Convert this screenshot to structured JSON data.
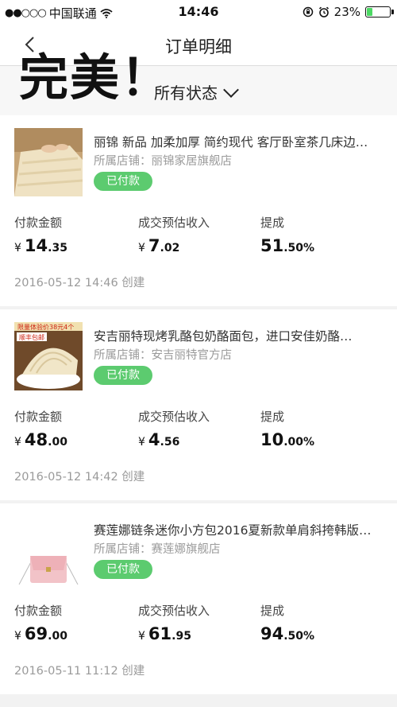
{
  "status_bar": {
    "carrier": "中国联通",
    "time": "14:46",
    "battery": "23%",
    "battery_level": 0.23
  },
  "nav": {
    "title": "订单明细"
  },
  "overlay_text": "完美！",
  "filter": {
    "label": "所有状态"
  },
  "colors": {
    "badge_green": "#5ccb6f",
    "battery_green": "#4cd964"
  },
  "orders": [
    {
      "title": "丽锦 新品 加柔加厚 简约现代 客厅卧室茶几床边…",
      "shop": "所属店铺：丽锦家居旗舰店",
      "status": "已付款",
      "pay_label": "付款金额",
      "income_label": "成交预估收入",
      "commission_label": "提成",
      "currency": "¥",
      "pay_int": "14",
      "pay_dec": ".35",
      "income_int": "7",
      "income_dec": ".02",
      "commission_int": "51",
      "commission_dec": ".50%",
      "created": "2016-05-12 14:46 创建"
    },
    {
      "title": "安吉丽特现烤乳酪包奶酪面包，进口安佳奶酪…",
      "shop": "所属店铺：安吉丽特官方店",
      "status": "已付款",
      "pay_label": "付款金额",
      "income_label": "成交预估收入",
      "commission_label": "提成",
      "currency": "¥",
      "pay_int": "48",
      "pay_dec": ".00",
      "income_int": "4",
      "income_dec": ".56",
      "commission_int": "10",
      "commission_dec": ".00%",
      "created": "2016-05-12 14:42 创建",
      "thumb_top_text": "限量体验价38元4个",
      "thumb_tag_text": "顺丰包邮"
    },
    {
      "title": "赛莲娜链条迷你小方包2016夏新款单肩斜挎韩版…",
      "shop": "所属店铺：赛莲娜旗舰店",
      "status": "已付款",
      "pay_label": "付款金额",
      "income_label": "成交预估收入",
      "commission_label": "提成",
      "currency": "¥",
      "pay_int": "69",
      "pay_dec": ".00",
      "income_int": "61",
      "income_dec": ".95",
      "commission_int": "94",
      "commission_dec": ".50%",
      "created": "2016-05-11 11:12 创建"
    }
  ]
}
